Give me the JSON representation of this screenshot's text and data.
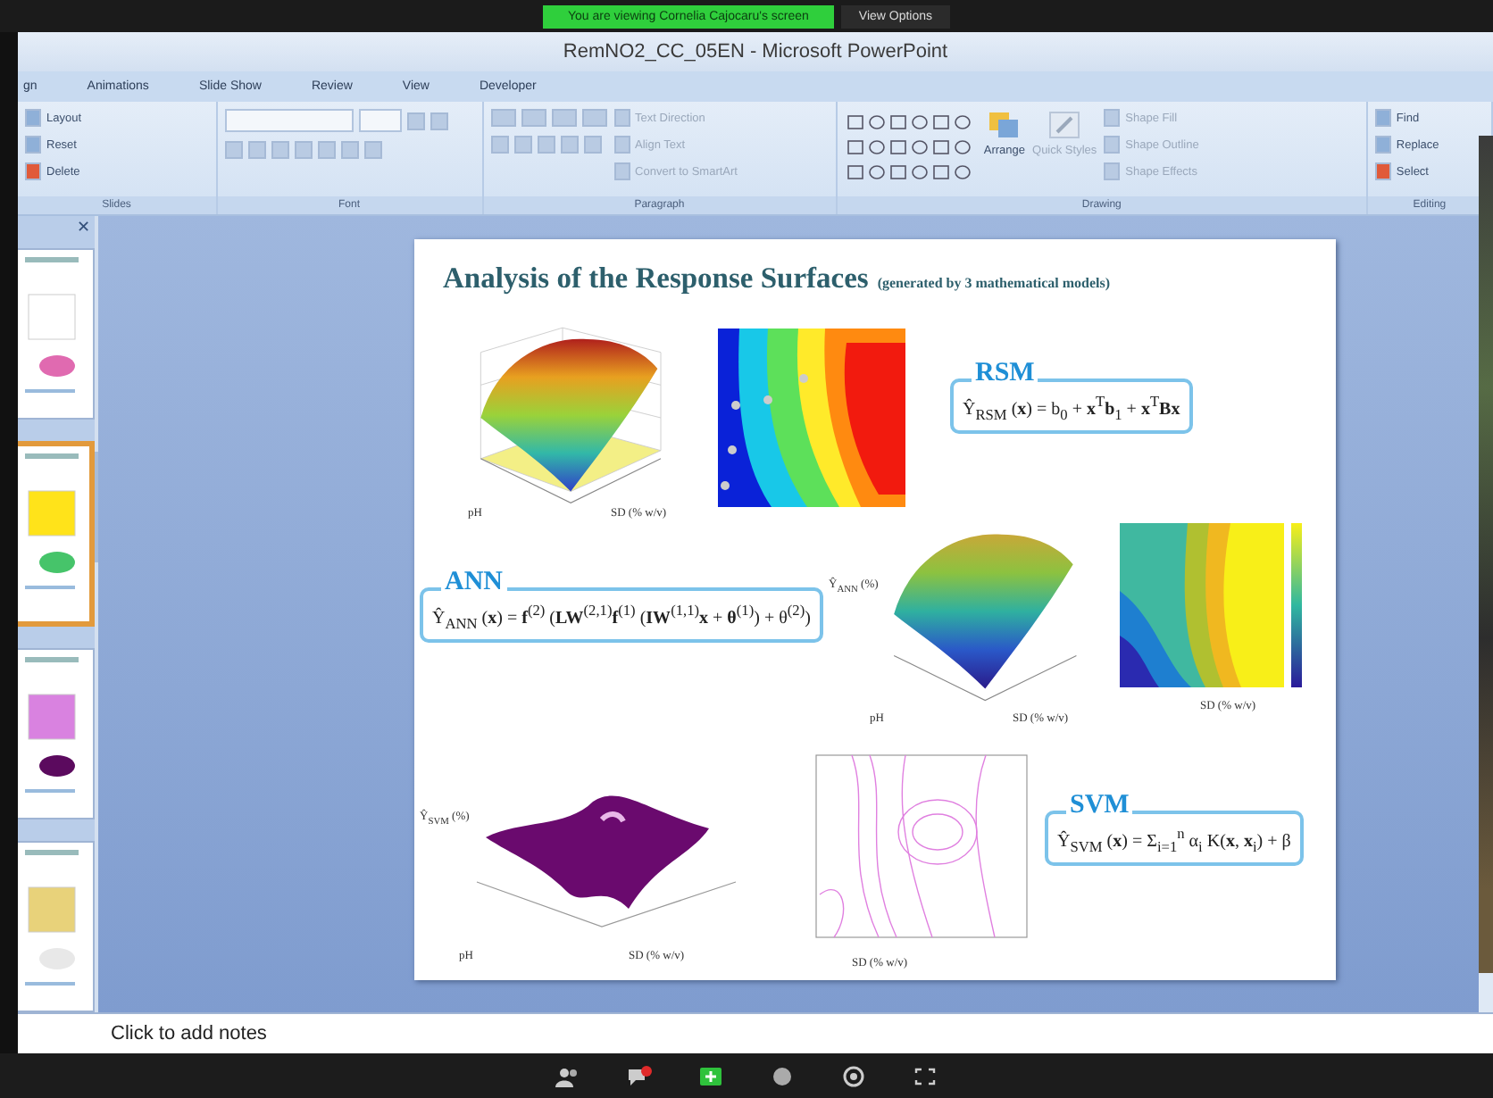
{
  "share_banner": {
    "text": "You are viewing Cornelia Cajocaru's screen",
    "options": "View Options"
  },
  "window": {
    "title": "RemNO2_CC_05EN - Microsoft PowerPoint"
  },
  "tabs": [
    {
      "label": "gn",
      "selected": false
    },
    {
      "label": "Animations",
      "selected": false
    },
    {
      "label": "Slide Show",
      "selected": false
    },
    {
      "label": "Review",
      "selected": false
    },
    {
      "label": "View",
      "selected": false
    },
    {
      "label": "Developer",
      "selected": false
    }
  ],
  "ribbon": [
    {
      "kind": "list",
      "label": "Slides",
      "items": [
        "Layout",
        "Reset",
        "Delete"
      ]
    },
    {
      "kind": "font",
      "label": "Font"
    },
    {
      "kind": "paragraph",
      "label": "Paragraph",
      "items": [
        "Text Direction",
        "Align Text",
        "Convert to SmartArt"
      ]
    },
    {
      "kind": "drawing",
      "label": "Drawing",
      "items": [
        "Arrange",
        "Quick Styles"
      ],
      "shape_items": [
        "Shape Fill",
        "Shape Outline",
        "Shape Effects"
      ]
    },
    {
      "kind": "list",
      "label": "Editing",
      "items": [
        "Find",
        "Replace",
        "Select"
      ]
    }
  ],
  "thumbnails": [
    {
      "selected": false
    },
    {
      "selected": true
    },
    {
      "selected": false
    },
    {
      "selected": false
    }
  ],
  "slide": {
    "title": "Analysis of the Response Surfaces",
    "subtitle": "(generated by 3 mathematical models)",
    "models": [
      {
        "label": "RSM",
        "formula": "Ŷ$_{RSM}$ (**x**) = b$_{0}$ + **x**$^{T}$**b**$_{1}$ + **x**$^{T}$**Bx**"
      },
      {
        "label": "ANN",
        "formula": "Ŷ$_{ANN}$ (**x**) = **f**$^{(2)}$ (**LW**$^{(2,1)}$**f**$^{(1)}$ (**IW**$^{(1,1)}$**x** + **θ**$^{(1)}$) + θ$^{(2)}$)"
      },
      {
        "label": "SVM",
        "formula": "Ŷ$_{SVM}$ (**x**) = Σ$_{i=1}$$^{n}$ α$_{i}$ K(**x**, **x**$_{i}$) + β"
      }
    ],
    "axis_labels": [
      "pH",
      "SD (% w/v)",
      "pH",
      "SD (% w/v)",
      "Ŷ$_{ANN}$ (%)",
      "SD (% w/v)",
      "pH",
      "SD (% w/v)",
      "Ŷ$_{SVM}$ (%)",
      "SD (% w/v)"
    ]
  },
  "thumbnail_pane": {
    "close": "✕"
  },
  "notes": {
    "placeholder": "Click to add notes"
  }
}
